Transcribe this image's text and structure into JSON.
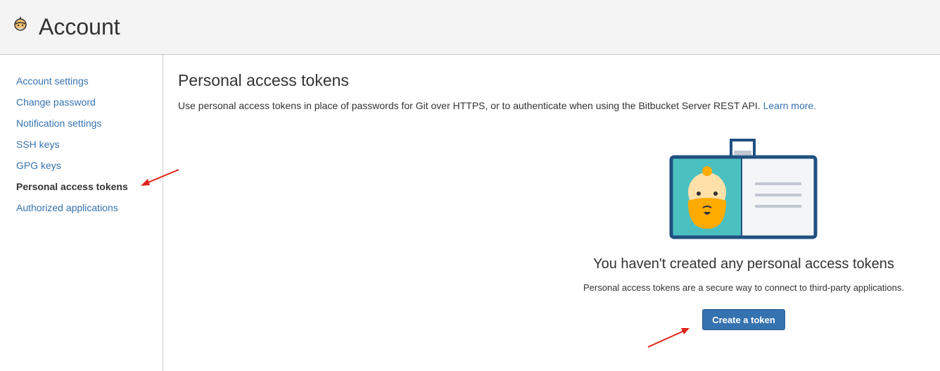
{
  "header": {
    "title": "Account",
    "avatar_icon": "user-avatar-icon"
  },
  "sidebar": {
    "items": [
      {
        "label": "Account settings",
        "active": false
      },
      {
        "label": "Change password",
        "active": false
      },
      {
        "label": "Notification settings",
        "active": false
      },
      {
        "label": "SSH keys",
        "active": false
      },
      {
        "label": "GPG keys",
        "active": false
      },
      {
        "label": "Personal access tokens",
        "active": true
      },
      {
        "label": "Authorized applications",
        "active": false
      }
    ]
  },
  "main": {
    "title": "Personal access tokens",
    "description": "Use personal access tokens in place of passwords for Git over HTTPS, or to authenticate when using the Bitbucket Server REST API.",
    "learn_more": "Learn more.",
    "empty_state": {
      "illustration_icon": "id-badge-icon",
      "title": "You haven't created any personal access tokens",
      "description": "Personal access tokens are a secure way to connect to third-party applications.",
      "button_label": "Create a token"
    }
  },
  "colors": {
    "link": "#3572b0",
    "button": "#3572b0",
    "header_bg": "#f4f4f4",
    "annotation_arrow": "#e2231a"
  }
}
